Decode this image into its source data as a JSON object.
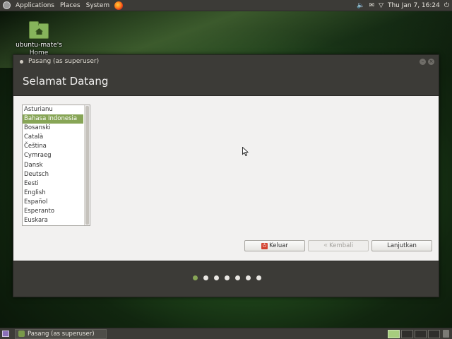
{
  "top_panel": {
    "menus": [
      "Applications",
      "Places",
      "System"
    ],
    "clock": "Thu Jan 7, 16:24",
    "tray_icons": [
      "volume-icon",
      "mail-icon",
      "network-icon",
      "power-icon"
    ]
  },
  "desktop": {
    "icon_label": "ubuntu-mate's Home"
  },
  "window": {
    "title": "Pasang (as superuser)",
    "heading": "Selamat Datang",
    "languages": [
      "Asturianu",
      "Bahasa Indonesia",
      "Bosanski",
      "Català",
      "Čeština",
      "Cymraeg",
      "Dansk",
      "Deutsch",
      "Eesti",
      "English",
      "Español",
      "Esperanto",
      "Euskara"
    ],
    "selected_language": "Bahasa Indonesia",
    "buttons": {
      "quit": "Keluar",
      "back": "Kembali",
      "next": "Lanjutkan"
    },
    "progress": {
      "current_step": 1,
      "total_steps": 7
    }
  },
  "bottom_panel": {
    "task_label": "Pasang (as superuser)",
    "workspaces": 4,
    "active_workspace": 1
  },
  "colors": {
    "accent": "#87a556",
    "panel": "#3c3b37",
    "window_bg": "#f2f1f0"
  }
}
